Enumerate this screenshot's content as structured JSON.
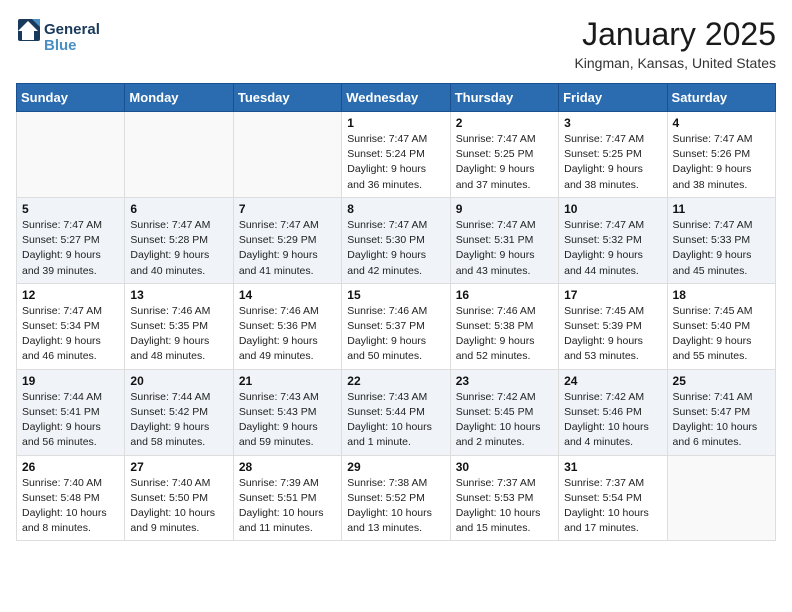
{
  "logo": {
    "general": "General",
    "blue": "Blue",
    "tagline": ""
  },
  "header": {
    "month_year": "January 2025",
    "location": "Kingman, Kansas, United States"
  },
  "weekdays": [
    "Sunday",
    "Monday",
    "Tuesday",
    "Wednesday",
    "Thursday",
    "Friday",
    "Saturday"
  ],
  "weeks": [
    [
      {
        "day": "",
        "detail": ""
      },
      {
        "day": "",
        "detail": ""
      },
      {
        "day": "",
        "detail": ""
      },
      {
        "day": "1",
        "detail": "Sunrise: 7:47 AM\nSunset: 5:24 PM\nDaylight: 9 hours\nand 36 minutes."
      },
      {
        "day": "2",
        "detail": "Sunrise: 7:47 AM\nSunset: 5:25 PM\nDaylight: 9 hours\nand 37 minutes."
      },
      {
        "day": "3",
        "detail": "Sunrise: 7:47 AM\nSunset: 5:25 PM\nDaylight: 9 hours\nand 38 minutes."
      },
      {
        "day": "4",
        "detail": "Sunrise: 7:47 AM\nSunset: 5:26 PM\nDaylight: 9 hours\nand 38 minutes."
      }
    ],
    [
      {
        "day": "5",
        "detail": "Sunrise: 7:47 AM\nSunset: 5:27 PM\nDaylight: 9 hours\nand 39 minutes."
      },
      {
        "day": "6",
        "detail": "Sunrise: 7:47 AM\nSunset: 5:28 PM\nDaylight: 9 hours\nand 40 minutes."
      },
      {
        "day": "7",
        "detail": "Sunrise: 7:47 AM\nSunset: 5:29 PM\nDaylight: 9 hours\nand 41 minutes."
      },
      {
        "day": "8",
        "detail": "Sunrise: 7:47 AM\nSunset: 5:30 PM\nDaylight: 9 hours\nand 42 minutes."
      },
      {
        "day": "9",
        "detail": "Sunrise: 7:47 AM\nSunset: 5:31 PM\nDaylight: 9 hours\nand 43 minutes."
      },
      {
        "day": "10",
        "detail": "Sunrise: 7:47 AM\nSunset: 5:32 PM\nDaylight: 9 hours\nand 44 minutes."
      },
      {
        "day": "11",
        "detail": "Sunrise: 7:47 AM\nSunset: 5:33 PM\nDaylight: 9 hours\nand 45 minutes."
      }
    ],
    [
      {
        "day": "12",
        "detail": "Sunrise: 7:47 AM\nSunset: 5:34 PM\nDaylight: 9 hours\nand 46 minutes."
      },
      {
        "day": "13",
        "detail": "Sunrise: 7:46 AM\nSunset: 5:35 PM\nDaylight: 9 hours\nand 48 minutes."
      },
      {
        "day": "14",
        "detail": "Sunrise: 7:46 AM\nSunset: 5:36 PM\nDaylight: 9 hours\nand 49 minutes."
      },
      {
        "day": "15",
        "detail": "Sunrise: 7:46 AM\nSunset: 5:37 PM\nDaylight: 9 hours\nand 50 minutes."
      },
      {
        "day": "16",
        "detail": "Sunrise: 7:46 AM\nSunset: 5:38 PM\nDaylight: 9 hours\nand 52 minutes."
      },
      {
        "day": "17",
        "detail": "Sunrise: 7:45 AM\nSunset: 5:39 PM\nDaylight: 9 hours\nand 53 minutes."
      },
      {
        "day": "18",
        "detail": "Sunrise: 7:45 AM\nSunset: 5:40 PM\nDaylight: 9 hours\nand 55 minutes."
      }
    ],
    [
      {
        "day": "19",
        "detail": "Sunrise: 7:44 AM\nSunset: 5:41 PM\nDaylight: 9 hours\nand 56 minutes."
      },
      {
        "day": "20",
        "detail": "Sunrise: 7:44 AM\nSunset: 5:42 PM\nDaylight: 9 hours\nand 58 minutes."
      },
      {
        "day": "21",
        "detail": "Sunrise: 7:43 AM\nSunset: 5:43 PM\nDaylight: 9 hours\nand 59 minutes."
      },
      {
        "day": "22",
        "detail": "Sunrise: 7:43 AM\nSunset: 5:44 PM\nDaylight: 10 hours\nand 1 minute."
      },
      {
        "day": "23",
        "detail": "Sunrise: 7:42 AM\nSunset: 5:45 PM\nDaylight: 10 hours\nand 2 minutes."
      },
      {
        "day": "24",
        "detail": "Sunrise: 7:42 AM\nSunset: 5:46 PM\nDaylight: 10 hours\nand 4 minutes."
      },
      {
        "day": "25",
        "detail": "Sunrise: 7:41 AM\nSunset: 5:47 PM\nDaylight: 10 hours\nand 6 minutes."
      }
    ],
    [
      {
        "day": "26",
        "detail": "Sunrise: 7:40 AM\nSunset: 5:48 PM\nDaylight: 10 hours\nand 8 minutes."
      },
      {
        "day": "27",
        "detail": "Sunrise: 7:40 AM\nSunset: 5:50 PM\nDaylight: 10 hours\nand 9 minutes."
      },
      {
        "day": "28",
        "detail": "Sunrise: 7:39 AM\nSunset: 5:51 PM\nDaylight: 10 hours\nand 11 minutes."
      },
      {
        "day": "29",
        "detail": "Sunrise: 7:38 AM\nSunset: 5:52 PM\nDaylight: 10 hours\nand 13 minutes."
      },
      {
        "day": "30",
        "detail": "Sunrise: 7:37 AM\nSunset: 5:53 PM\nDaylight: 10 hours\nand 15 minutes."
      },
      {
        "day": "31",
        "detail": "Sunrise: 7:37 AM\nSunset: 5:54 PM\nDaylight: 10 hours\nand 17 minutes."
      },
      {
        "day": "",
        "detail": ""
      }
    ]
  ]
}
